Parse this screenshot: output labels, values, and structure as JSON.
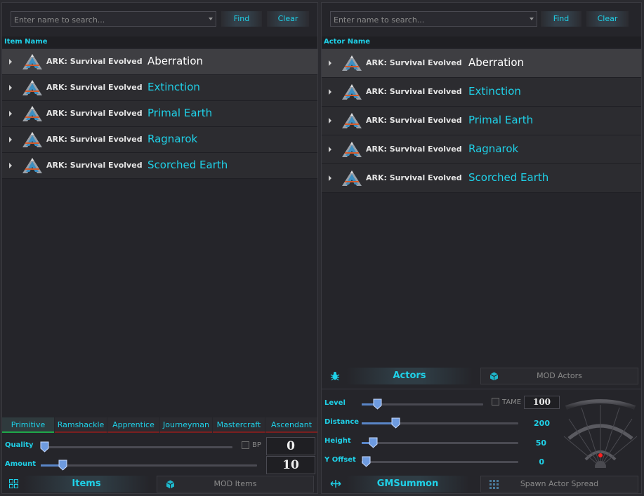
{
  "left": {
    "search": {
      "placeholder": "Enter name to search...",
      "find": "Find",
      "clear": "Clear"
    },
    "column_header": "Item Name",
    "rows": [
      {
        "game": "ARK: Survival Evolved",
        "map": "Aberration",
        "selected": true
      },
      {
        "game": "ARK: Survival Evolved",
        "map": "Extinction"
      },
      {
        "game": "ARK: Survival Evolved",
        "map": "Primal Earth"
      },
      {
        "game": "ARK: Survival Evolved",
        "map": "Ragnarok"
      },
      {
        "game": "ARK: Survival Evolved",
        "map": "Scorched Earth"
      }
    ],
    "quality_tabs": [
      "Primitive",
      "Ramshackle",
      "Apprentice",
      "Journeyman",
      "Mastercraft",
      "Ascendant"
    ],
    "active_quality": "Primitive",
    "quality": {
      "label": "Quality",
      "value": "0",
      "level": 0.0,
      "bp_label": "BP",
      "bp_checked": false
    },
    "amount": {
      "label": "Amount",
      "value": "10",
      "level": 0.1
    },
    "tabs": {
      "main": "Items",
      "secondary": "MOD Items"
    }
  },
  "right": {
    "search": {
      "placeholder": "Enter name to search...",
      "find": "Find",
      "clear": "Clear"
    },
    "column_header": "Actor Name",
    "rows": [
      {
        "game": "ARK: Survival Evolved",
        "map": "Aberration",
        "selected": true
      },
      {
        "game": "ARK: Survival Evolved",
        "map": "Extinction"
      },
      {
        "game": "ARK: Survival Evolved",
        "map": "Primal Earth"
      },
      {
        "game": "ARK: Survival Evolved",
        "map": "Ragnarok"
      },
      {
        "game": "ARK: Survival Evolved",
        "map": "Scorched Earth"
      }
    ],
    "tabs": {
      "main": "Actors",
      "secondary": "MOD Actors"
    },
    "level": {
      "label": "Level",
      "value": "100",
      "level": 0.1,
      "tame_label": "TAME",
      "tame_checked": false
    },
    "distance": {
      "label": "Distance",
      "value": "200",
      "level": 0.2
    },
    "height": {
      "label": "Height",
      "value": "50",
      "level": 0.05
    },
    "yoffset": {
      "label": "Y Offset",
      "value": "0",
      "level": 0.0
    },
    "bottom_tabs": {
      "main": "GMSummon",
      "secondary": "Spawn Actor Spread"
    }
  },
  "colors": {
    "accent": "#1fd1e8",
    "background": "#25252a",
    "selected_row": "#3e3e42",
    "active_tab_underline": "#1fa84a",
    "tab_underline": "#7a1f1f",
    "radar_dot": "#ff2020"
  },
  "icons": [
    "chevron-right-icon",
    "ark-logo-icon",
    "grid-icon",
    "cube-icon",
    "bug-icon",
    "move-icon",
    "grid-dots-icon",
    "radar-icon"
  ]
}
